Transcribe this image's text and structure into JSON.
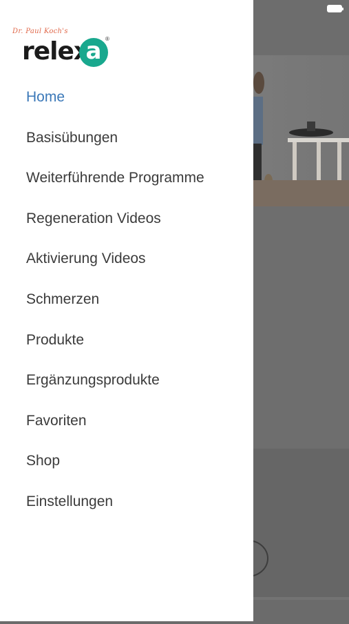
{
  "status_bar": {
    "battery_icon": "battery-icon"
  },
  "logo": {
    "tagline": "Dr. Paul Koch's",
    "word": "relex",
    "badge_letter": "a",
    "registered": "®",
    "colors": {
      "tagline": "#e0684a",
      "badge": "#19a88e"
    }
  },
  "drawer": {
    "items": [
      {
        "label": "Home",
        "active": true
      },
      {
        "label": "Basisübungen"
      },
      {
        "label": "Weiterführende Programme"
      },
      {
        "label": "Regeneration Videos"
      },
      {
        "label": "Aktivierung Videos"
      },
      {
        "label": "Schmerzen"
      },
      {
        "label": "Produkte"
      },
      {
        "label": "Ergänzungsprodukte"
      },
      {
        "label": "Favoriten"
      },
      {
        "label": "Shop"
      },
      {
        "label": "Einstellungen"
      }
    ],
    "active_color": "#3b78b8"
  },
  "background": {
    "link_fragment": "dern"
  }
}
